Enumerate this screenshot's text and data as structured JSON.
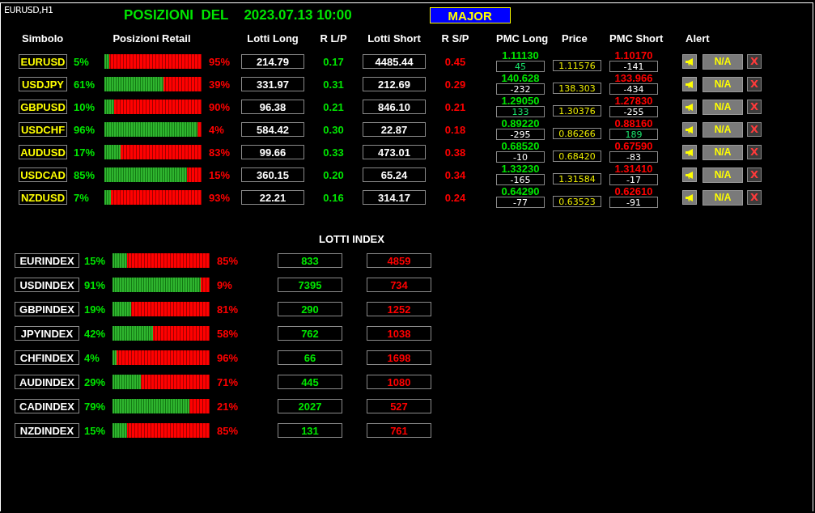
{
  "chart_label": "EURUSD,H1",
  "title": "POSIZIONI  DEL",
  "date": "2023.07.13 10:00",
  "group_button": "MAJOR",
  "headers": [
    "Simbolo",
    "Posizioni Retail",
    "Lotti Long",
    "R L/P",
    "Lotti Short",
    "R S/P",
    "PMC Long",
    "Price",
    "PMC Short",
    "Alert"
  ],
  "pairs": [
    {
      "symbol": "EURUSD",
      "long_pct": "5%",
      "level": 0.05,
      "short_pct": "95%",
      "lotti_long": "214.79",
      "r_lp": "0.17",
      "lotti_short": "4485.44",
      "r_sp": "0.45",
      "pmc_long": "1.11130",
      "pmc_long_diff": "45",
      "pmc_long_positive": true,
      "price": "1.11576",
      "pmc_short": "1.10170",
      "pmc_short_diff": "-141",
      "pmc_short_positive": false,
      "alert": "N/A",
      "remove": "X"
    },
    {
      "symbol": "USDJPY",
      "long_pct": "61%",
      "level": 0.61,
      "short_pct": "39%",
      "lotti_long": "331.97",
      "r_lp": "0.31",
      "lotti_short": "212.69",
      "r_sp": "0.29",
      "pmc_long": "140.628",
      "pmc_long_diff": "-232",
      "pmc_long_positive": false,
      "price": "138.303",
      "pmc_short": "133.966",
      "pmc_short_diff": "-434",
      "pmc_short_positive": false,
      "alert": "N/A",
      "remove": "X"
    },
    {
      "symbol": "GBPUSD",
      "long_pct": "10%",
      "level": 0.1,
      "short_pct": "90%",
      "lotti_long": "96.38",
      "r_lp": "0.21",
      "lotti_short": "846.10",
      "r_sp": "0.21",
      "pmc_long": "1.29050",
      "pmc_long_diff": "133",
      "pmc_long_positive": true,
      "price": "1.30376",
      "pmc_short": "1.27830",
      "pmc_short_diff": "-255",
      "pmc_short_positive": false,
      "alert": "N/A",
      "remove": "X"
    },
    {
      "symbol": "USDCHF",
      "long_pct": "96%",
      "level": 0.96,
      "short_pct": "4%",
      "lotti_long": "584.42",
      "r_lp": "0.30",
      "lotti_short": "22.87",
      "r_sp": "0.18",
      "pmc_long": "0.89220",
      "pmc_long_diff": "-295",
      "pmc_long_positive": false,
      "price": "0.86266",
      "pmc_short": "0.88160",
      "pmc_short_diff": "189",
      "pmc_short_positive": true,
      "alert": "N/A",
      "remove": "X"
    },
    {
      "symbol": "AUDUSD",
      "long_pct": "17%",
      "level": 0.17,
      "short_pct": "83%",
      "lotti_long": "99.66",
      "r_lp": "0.33",
      "lotti_short": "473.01",
      "r_sp": "0.38",
      "pmc_long": "0.68520",
      "pmc_long_diff": "-10",
      "pmc_long_positive": false,
      "price": "0.68420",
      "pmc_short": "0.67590",
      "pmc_short_diff": "-83",
      "pmc_short_positive": false,
      "alert": "N/A",
      "remove": "X"
    },
    {
      "symbol": "USDCAD",
      "long_pct": "85%",
      "level": 0.85,
      "short_pct": "15%",
      "lotti_long": "360.15",
      "r_lp": "0.20",
      "lotti_short": "65.24",
      "r_sp": "0.34",
      "pmc_long": "1.33230",
      "pmc_long_diff": "-165",
      "pmc_long_positive": false,
      "price": "1.31584",
      "pmc_short": "1.31410",
      "pmc_short_diff": "-17",
      "pmc_short_positive": false,
      "alert": "N/A",
      "remove": "X"
    },
    {
      "symbol": "NZDUSD",
      "long_pct": "7%",
      "level": 0.07,
      "short_pct": "93%",
      "lotti_long": "22.21",
      "r_lp": "0.16",
      "lotti_short": "314.17",
      "r_sp": "0.24",
      "pmc_long": "0.64290",
      "pmc_long_diff": "-77",
      "pmc_long_positive": false,
      "price": "0.63523",
      "pmc_short": "0.62610",
      "pmc_short_diff": "-91",
      "pmc_short_positive": false,
      "alert": "N/A",
      "remove": "X"
    }
  ],
  "index_title": "LOTTI INDEX",
  "indexes": [
    {
      "name": "EURINDEX",
      "long_pct": "15%",
      "level": 0.15,
      "short_pct": "85%",
      "lotti_long": "833",
      "lotti_short": "4859"
    },
    {
      "name": "USDINDEX",
      "long_pct": "91%",
      "level": 0.91,
      "short_pct": "9%",
      "lotti_long": "7395",
      "lotti_short": "734"
    },
    {
      "name": "GBPINDEX",
      "long_pct": "19%",
      "level": 0.19,
      "short_pct": "81%",
      "lotti_long": "290",
      "lotti_short": "1252"
    },
    {
      "name": "JPYINDEX",
      "long_pct": "42%",
      "level": 0.42,
      "short_pct": "58%",
      "lotti_long": "762",
      "lotti_short": "1038"
    },
    {
      "name": "CHFINDEX",
      "long_pct": "4%",
      "level": 0.04,
      "short_pct": "96%",
      "lotti_long": "66",
      "lotti_short": "1698"
    },
    {
      "name": "AUDINDEX",
      "long_pct": "29%",
      "level": 0.29,
      "short_pct": "71%",
      "lotti_long": "445",
      "lotti_short": "1080"
    },
    {
      "name": "CADINDEX",
      "long_pct": "79%",
      "level": 0.79,
      "short_pct": "21%",
      "lotti_long": "2027",
      "lotti_short": "527"
    },
    {
      "name": "NZDINDEX",
      "long_pct": "15%",
      "level": 0.15,
      "short_pct": "85%",
      "lotti_long": "131",
      "lotti_short": "761"
    }
  ]
}
